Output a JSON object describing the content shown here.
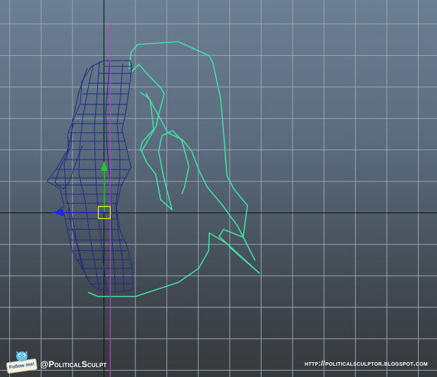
{
  "viewport": {
    "name": "3D modeling viewport - side view",
    "colors": {
      "grid_line": "#9aa6b3",
      "axis_line": "#0d0f12",
      "hair_curve": "#3fe3a5",
      "mesh_wire": "#1d2a86",
      "pivot_line": "#c33ad6",
      "manipulator_y": "#1ecc2a",
      "manipulator_z": "#2222ff",
      "manipulator_center": "#f3f300"
    }
  },
  "footer": {
    "twitter_handle": "@PoliticalSculpt",
    "blog_url": "http://politicalsculptor.blogspot.com",
    "badge": {
      "label": "Follow me!",
      "icon": "twitter-bird-icon"
    }
  }
}
